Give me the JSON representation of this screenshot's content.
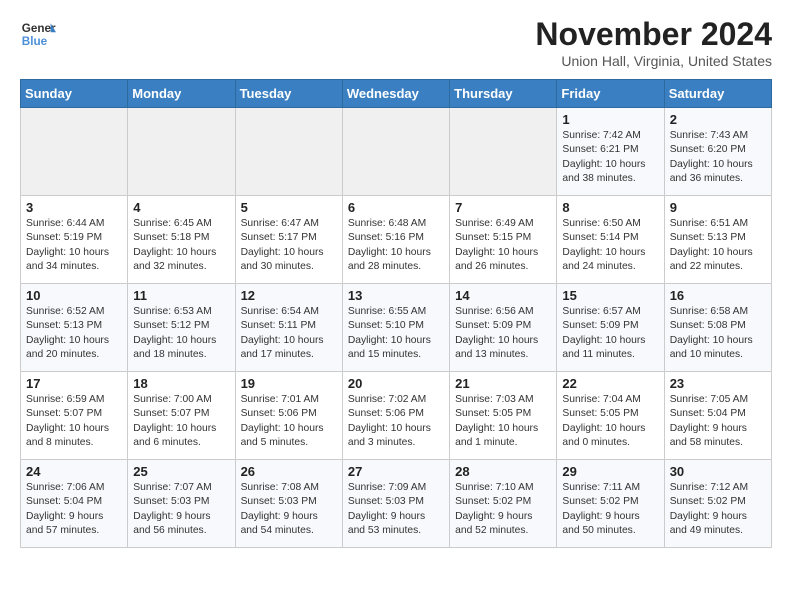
{
  "logo": {
    "line1": "General",
    "line2": "Blue"
  },
  "title": "November 2024",
  "location": "Union Hall, Virginia, United States",
  "days_of_week": [
    "Sunday",
    "Monday",
    "Tuesday",
    "Wednesday",
    "Thursday",
    "Friday",
    "Saturday"
  ],
  "weeks": [
    [
      {
        "day": "",
        "text": ""
      },
      {
        "day": "",
        "text": ""
      },
      {
        "day": "",
        "text": ""
      },
      {
        "day": "",
        "text": ""
      },
      {
        "day": "",
        "text": ""
      },
      {
        "day": "1",
        "text": "Sunrise: 7:42 AM\nSunset: 6:21 PM\nDaylight: 10 hours\nand 38 minutes."
      },
      {
        "day": "2",
        "text": "Sunrise: 7:43 AM\nSunset: 6:20 PM\nDaylight: 10 hours\nand 36 minutes."
      }
    ],
    [
      {
        "day": "3",
        "text": "Sunrise: 6:44 AM\nSunset: 5:19 PM\nDaylight: 10 hours\nand 34 minutes."
      },
      {
        "day": "4",
        "text": "Sunrise: 6:45 AM\nSunset: 5:18 PM\nDaylight: 10 hours\nand 32 minutes."
      },
      {
        "day": "5",
        "text": "Sunrise: 6:47 AM\nSunset: 5:17 PM\nDaylight: 10 hours\nand 30 minutes."
      },
      {
        "day": "6",
        "text": "Sunrise: 6:48 AM\nSunset: 5:16 PM\nDaylight: 10 hours\nand 28 minutes."
      },
      {
        "day": "7",
        "text": "Sunrise: 6:49 AM\nSunset: 5:15 PM\nDaylight: 10 hours\nand 26 minutes."
      },
      {
        "day": "8",
        "text": "Sunrise: 6:50 AM\nSunset: 5:14 PM\nDaylight: 10 hours\nand 24 minutes."
      },
      {
        "day": "9",
        "text": "Sunrise: 6:51 AM\nSunset: 5:13 PM\nDaylight: 10 hours\nand 22 minutes."
      }
    ],
    [
      {
        "day": "10",
        "text": "Sunrise: 6:52 AM\nSunset: 5:13 PM\nDaylight: 10 hours\nand 20 minutes."
      },
      {
        "day": "11",
        "text": "Sunrise: 6:53 AM\nSunset: 5:12 PM\nDaylight: 10 hours\nand 18 minutes."
      },
      {
        "day": "12",
        "text": "Sunrise: 6:54 AM\nSunset: 5:11 PM\nDaylight: 10 hours\nand 17 minutes."
      },
      {
        "day": "13",
        "text": "Sunrise: 6:55 AM\nSunset: 5:10 PM\nDaylight: 10 hours\nand 15 minutes."
      },
      {
        "day": "14",
        "text": "Sunrise: 6:56 AM\nSunset: 5:09 PM\nDaylight: 10 hours\nand 13 minutes."
      },
      {
        "day": "15",
        "text": "Sunrise: 6:57 AM\nSunset: 5:09 PM\nDaylight: 10 hours\nand 11 minutes."
      },
      {
        "day": "16",
        "text": "Sunrise: 6:58 AM\nSunset: 5:08 PM\nDaylight: 10 hours\nand 10 minutes."
      }
    ],
    [
      {
        "day": "17",
        "text": "Sunrise: 6:59 AM\nSunset: 5:07 PM\nDaylight: 10 hours\nand 8 minutes."
      },
      {
        "day": "18",
        "text": "Sunrise: 7:00 AM\nSunset: 5:07 PM\nDaylight: 10 hours\nand 6 minutes."
      },
      {
        "day": "19",
        "text": "Sunrise: 7:01 AM\nSunset: 5:06 PM\nDaylight: 10 hours\nand 5 minutes."
      },
      {
        "day": "20",
        "text": "Sunrise: 7:02 AM\nSunset: 5:06 PM\nDaylight: 10 hours\nand 3 minutes."
      },
      {
        "day": "21",
        "text": "Sunrise: 7:03 AM\nSunset: 5:05 PM\nDaylight: 10 hours\nand 1 minute."
      },
      {
        "day": "22",
        "text": "Sunrise: 7:04 AM\nSunset: 5:05 PM\nDaylight: 10 hours\nand 0 minutes."
      },
      {
        "day": "23",
        "text": "Sunrise: 7:05 AM\nSunset: 5:04 PM\nDaylight: 9 hours\nand 58 minutes."
      }
    ],
    [
      {
        "day": "24",
        "text": "Sunrise: 7:06 AM\nSunset: 5:04 PM\nDaylight: 9 hours\nand 57 minutes."
      },
      {
        "day": "25",
        "text": "Sunrise: 7:07 AM\nSunset: 5:03 PM\nDaylight: 9 hours\nand 56 minutes."
      },
      {
        "day": "26",
        "text": "Sunrise: 7:08 AM\nSunset: 5:03 PM\nDaylight: 9 hours\nand 54 minutes."
      },
      {
        "day": "27",
        "text": "Sunrise: 7:09 AM\nSunset: 5:03 PM\nDaylight: 9 hours\nand 53 minutes."
      },
      {
        "day": "28",
        "text": "Sunrise: 7:10 AM\nSunset: 5:02 PM\nDaylight: 9 hours\nand 52 minutes."
      },
      {
        "day": "29",
        "text": "Sunrise: 7:11 AM\nSunset: 5:02 PM\nDaylight: 9 hours\nand 50 minutes."
      },
      {
        "day": "30",
        "text": "Sunrise: 7:12 AM\nSunset: 5:02 PM\nDaylight: 9 hours\nand 49 minutes."
      }
    ]
  ]
}
